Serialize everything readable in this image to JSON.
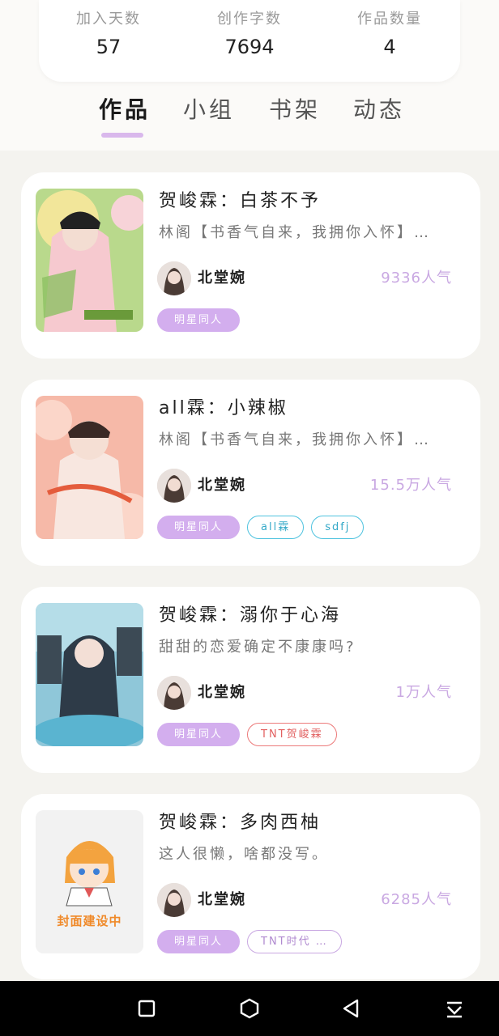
{
  "stats": [
    {
      "label": "加入天数",
      "value": "57"
    },
    {
      "label": "创作字数",
      "value": "7694"
    },
    {
      "label": "作品数量",
      "value": "4"
    }
  ],
  "tabs": [
    {
      "label": "作品",
      "active": true
    },
    {
      "label": "小组",
      "active": false
    },
    {
      "label": "书架",
      "active": false
    },
    {
      "label": "动态",
      "active": false
    }
  ],
  "works": [
    {
      "title": "贺峻霖：白茶不予",
      "desc": "林阁【书香气自来，我拥你入怀】…",
      "author": "北堂婉",
      "popularity": "9336人气",
      "tags": [
        {
          "label": "明星同人",
          "style": "primary"
        }
      ]
    },
    {
      "title": "all霖：小辣椒",
      "desc": "林阁【书香气自来，我拥你入怀】…",
      "author": "北堂婉",
      "popularity": "15.5万人气",
      "tags": [
        {
          "label": "明星同人",
          "style": "primary"
        },
        {
          "label": "all霖",
          "style": "cyan"
        },
        {
          "label": "sdfj",
          "style": "cyan"
        }
      ]
    },
    {
      "title": "贺峻霖：溺你于心海",
      "desc": "甜甜的恋爱确定不康康吗?",
      "author": "北堂婉",
      "popularity": "1万人气",
      "tags": [
        {
          "label": "明星同人",
          "style": "primary"
        },
        {
          "label": "TNT贺峻霖",
          "style": "red"
        }
      ]
    },
    {
      "title": "贺峻霖：多肉西柚",
      "desc": "这人很懒，啥都没写。",
      "author": "北堂婉",
      "popularity": "6285人气",
      "cover_text": "封面建设中",
      "tags": [
        {
          "label": "明星同人",
          "style": "primary"
        },
        {
          "label": "TNT时代 …",
          "style": "purple-o"
        }
      ]
    }
  ],
  "colors": {
    "accent": "#d3aeee",
    "popularity": "#c9a8e2",
    "background": "#f4f3ef"
  },
  "icons": {
    "nav_recent": "square-icon",
    "nav_home": "hexagon-icon",
    "nav_back": "triangle-back-icon",
    "nav_menu": "download-tray-icon"
  }
}
